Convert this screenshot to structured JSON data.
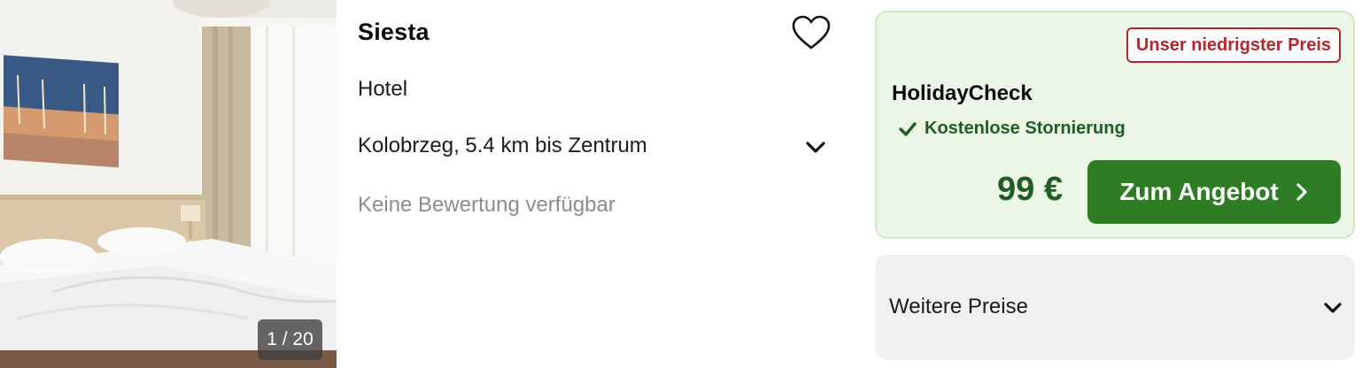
{
  "photo": {
    "counter": "1 / 20",
    "alt": "hotel-room-photo"
  },
  "hotel": {
    "name": "Siesta",
    "type": "Hotel",
    "location": "Kolobrzeg, 5.4 km bis Zentrum",
    "rating": "Keine Bewertung verfügbar"
  },
  "deal": {
    "badge": "Unser niedrigster Preis",
    "provider": "HolidayCheck",
    "cancellation": "Kostenlose Stornierung",
    "price": "99 €",
    "cta_label": "Zum Angebot"
  },
  "more_prices": {
    "label": "Weitere Preise"
  },
  "colors": {
    "deal_background": "#ebf6e6",
    "deal_border": "#cfe7c4",
    "badge_red": "#b6242c",
    "price_green": "#1f5e23",
    "cta_green": "#2e7d25",
    "more_background": "#f0f1f2",
    "muted_text": "#8a8d90"
  },
  "icons": {
    "favorite": "heart-outline-icon",
    "expand_location": "chevron-down-icon",
    "cancellation": "check-icon",
    "cta": "chevron-right-icon",
    "expand_prices": "chevron-down-icon"
  }
}
